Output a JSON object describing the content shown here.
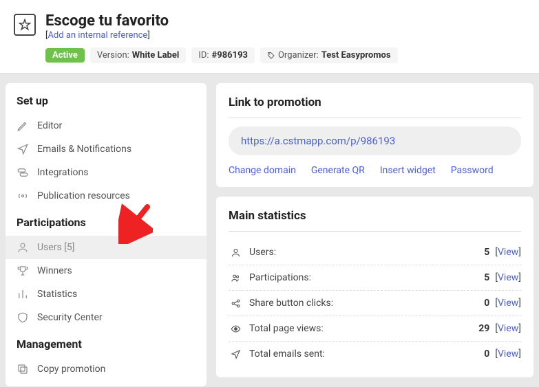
{
  "header": {
    "title": "Escoge tu favorito",
    "internal_ref_link": "Add an internal reference",
    "status_badge": "Active",
    "version_label": "Version:",
    "version_value": "White Label",
    "id_label": "ID:",
    "id_value": "#986193",
    "organizer_label": "Organizer:",
    "organizer_value": "Test Easypromos"
  },
  "sidebar": {
    "setup_title": "Set up",
    "setup": [
      {
        "label": "Editor"
      },
      {
        "label": "Emails & Notifications"
      },
      {
        "label": "Integrations"
      },
      {
        "label": "Publication resources"
      }
    ],
    "participations_title": "Participations",
    "participations": [
      {
        "label": "Users [5]"
      },
      {
        "label": "Winners"
      },
      {
        "label": "Statistics"
      },
      {
        "label": "Security Center"
      }
    ],
    "management_title": "Management",
    "management": [
      {
        "label": "Copy promotion"
      }
    ]
  },
  "link_panel": {
    "title": "Link to promotion",
    "url": "https://a.cstmapp.com/p/986193",
    "actions": [
      "Change domain",
      "Generate QR",
      "Insert widget",
      "Password"
    ]
  },
  "stats_panel": {
    "title": "Main statistics",
    "rows": [
      {
        "label": "Users:",
        "value": "5",
        "view": "View"
      },
      {
        "label": "Participations:",
        "value": "5",
        "view": "View"
      },
      {
        "label": "Share button clicks:",
        "value": "0",
        "view": "View"
      },
      {
        "label": "Total page views:",
        "value": "29",
        "view": "View"
      },
      {
        "label": "Total emails sent:",
        "value": "0",
        "view": "View"
      }
    ]
  }
}
